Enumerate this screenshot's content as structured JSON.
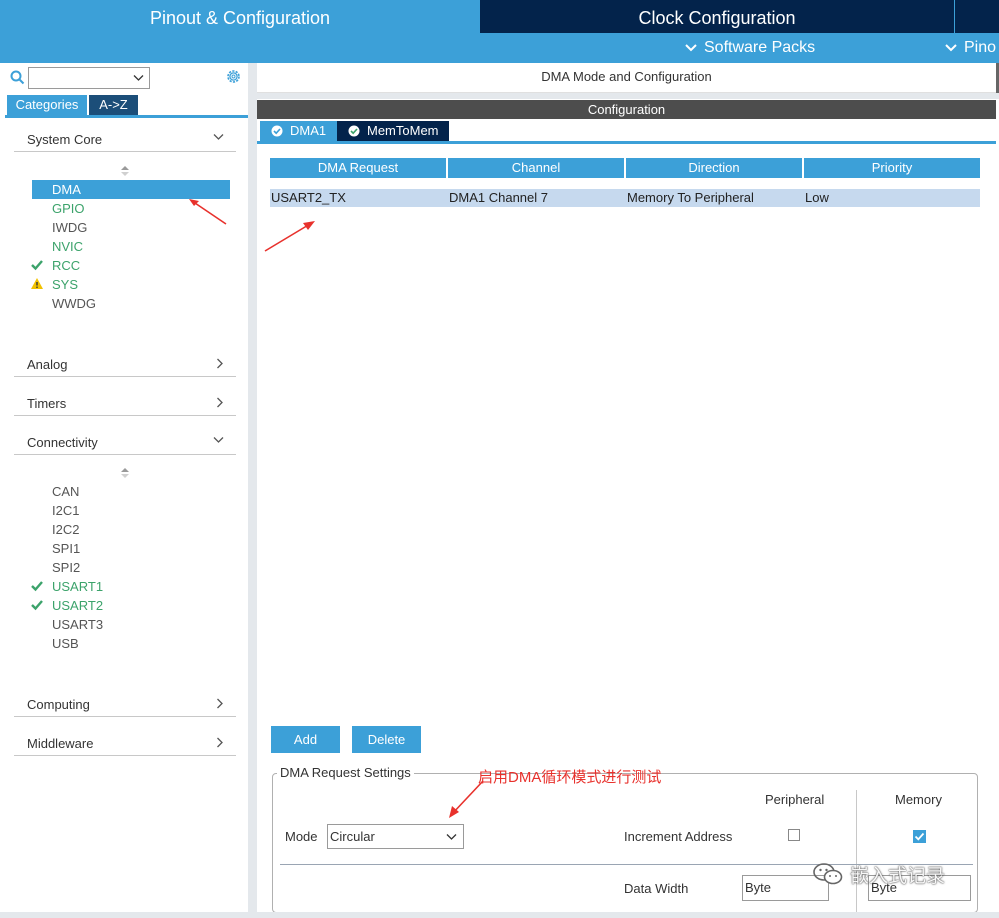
{
  "header": {
    "tabs": [
      {
        "label": "Pinout & Configuration",
        "active": true
      },
      {
        "label": "Clock Configuration",
        "active": false
      }
    ],
    "subnav": [
      "Software Packs",
      "Pino"
    ]
  },
  "sidebar": {
    "category_tabs": [
      "Categories",
      "A->Z"
    ],
    "sections": {
      "system_core": "System Core",
      "analog": "Analog",
      "timers": "Timers",
      "connectivity": "Connectivity",
      "computing": "Computing",
      "middleware": "Middleware"
    },
    "system_core_items": [
      {
        "label": "DMA",
        "status": "selected"
      },
      {
        "label": "GPIO",
        "status": "green"
      },
      {
        "label": "IWDG",
        "status": "plain"
      },
      {
        "label": "NVIC",
        "status": "green"
      },
      {
        "label": "RCC",
        "status": "check"
      },
      {
        "label": "SYS",
        "status": "warning"
      },
      {
        "label": "WWDG",
        "status": "plain"
      }
    ],
    "connectivity_items": [
      {
        "label": "CAN",
        "status": "plain"
      },
      {
        "label": "I2C1",
        "status": "plain"
      },
      {
        "label": "I2C2",
        "status": "plain"
      },
      {
        "label": "SPI1",
        "status": "plain"
      },
      {
        "label": "SPI2",
        "status": "plain"
      },
      {
        "label": "USART1",
        "status": "check"
      },
      {
        "label": "USART2",
        "status": "check"
      },
      {
        "label": "USART3",
        "status": "plain"
      },
      {
        "label": "USB",
        "status": "plain"
      }
    ]
  },
  "main": {
    "title": "DMA Mode and Configuration",
    "config_header": "Configuration",
    "subtabs": [
      "DMA1",
      "MemToMem"
    ],
    "table": {
      "headers": [
        "DMA Request",
        "Channel",
        "Direction",
        "Priority"
      ],
      "rows": [
        [
          "USART2_TX",
          "DMA1 Channel 7",
          "Memory To Peripheral",
          "Low"
        ]
      ]
    },
    "buttons": {
      "add": "Add",
      "delete": "Delete"
    },
    "settings": {
      "legend": "DMA Request Settings",
      "peripheral_col": "Peripheral",
      "memory_col": "Memory",
      "mode_label": "Mode",
      "mode_value": "Circular",
      "increment_label": "Increment Address",
      "peripheral_increment": false,
      "memory_increment": true,
      "data_width_label": "Data Width",
      "peripheral_width": "Byte",
      "memory_width": "Byte"
    }
  },
  "annotation": "启用DMA循环模式进行测试",
  "watermark": "嵌入式记录",
  "colors": {
    "accent": "#3ca0d8",
    "dark_navy": "#03234b",
    "green": "#3ca36b",
    "warning": "#f2c200",
    "annotation_red": "#e8312c"
  }
}
